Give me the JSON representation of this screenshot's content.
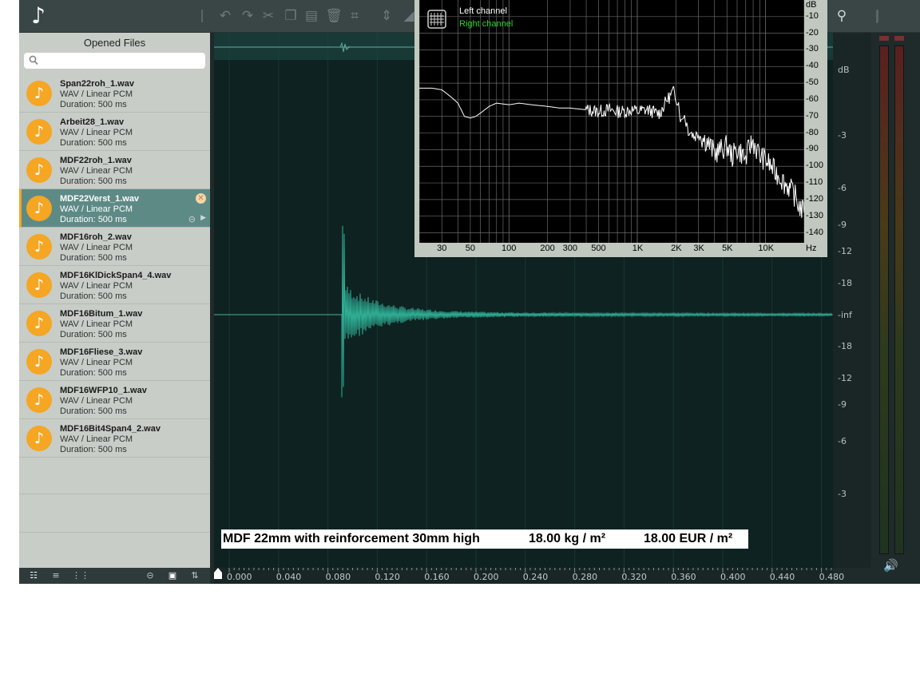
{
  "toolbar": {
    "logo_glyph": "♪",
    "buttons": [
      {
        "name": "undo-icon",
        "glyph": "↶"
      },
      {
        "name": "redo-icon",
        "glyph": "↷"
      },
      {
        "name": "cut-icon",
        "glyph": "✂"
      },
      {
        "name": "copy-icon",
        "glyph": "❐"
      },
      {
        "name": "paste-icon",
        "glyph": "▤"
      },
      {
        "name": "delete-icon",
        "glyph": "🗑"
      },
      {
        "name": "crop-icon",
        "glyph": "⌗"
      },
      {
        "name": "normalize-icon",
        "glyph": "⇕"
      },
      {
        "name": "fade-icon",
        "glyph": "◢"
      }
    ],
    "right_button": {
      "name": "tuning-fork-icon",
      "glyph": "⚲"
    }
  },
  "sidebar": {
    "title": "Opened Files",
    "search_placeholder": "",
    "files": [
      {
        "name": "Span22roh_1.wav",
        "format": "WAV / Linear PCM",
        "duration": "Duration: 500 ms",
        "selected": false
      },
      {
        "name": "Arbeit28_1.wav",
        "format": "WAV / Linear PCM",
        "duration": "Duration: 500 ms",
        "selected": false
      },
      {
        "name": "MDF22roh_1.wav",
        "format": "WAV / Linear PCM",
        "duration": "Duration: 500 ms",
        "selected": false
      },
      {
        "name": "MDF22Verst_1.wav",
        "format": "WAV / Linear PCM",
        "duration": "Duration: 500 ms",
        "selected": true
      },
      {
        "name": "MDF16roh_2.wav",
        "format": "WAV / Linear PCM",
        "duration": "Duration: 500 ms",
        "selected": false
      },
      {
        "name": "MDF16KlDickSpan4_4.wav",
        "format": "WAV / Linear PCM",
        "duration": "Duration: 500 ms",
        "selected": false
      },
      {
        "name": "MDF16Bitum_1.wav",
        "format": "WAV / Linear PCM",
        "duration": "Duration: 500 ms",
        "selected": false
      },
      {
        "name": "MDF16Fliese_3.wav",
        "format": "WAV / Linear PCM",
        "duration": "Duration: 500 ms",
        "selected": false
      },
      {
        "name": "MDF16WFP10_1.wav",
        "format": "WAV / Linear PCM",
        "duration": "Duration: 500 ms",
        "selected": false
      },
      {
        "name": "MDF16Bit4Span4_2.wav",
        "format": "WAV / Linear PCM",
        "duration": "Duration: 500 ms",
        "selected": false
      }
    ],
    "footer_buttons": [
      {
        "name": "detail-view-icon",
        "glyph": "☷"
      },
      {
        "name": "list-view-icon",
        "glyph": "≡"
      },
      {
        "name": "grid-view-icon",
        "glyph": "⋮⋮"
      },
      {
        "name": "link-icon",
        "glyph": "⊝"
      },
      {
        "name": "image-icon",
        "glyph": "▣"
      },
      {
        "name": "sort-icon",
        "glyph": "⇅"
      }
    ]
  },
  "waveform": {
    "db_scale_unit": "dB",
    "db_labels": [
      "-3",
      "-6",
      "-9",
      "-12",
      "-18",
      "-inf",
      "-18",
      "-12",
      "-9",
      "-6",
      "-3"
    ],
    "time_labels": [
      "0.000",
      "0.040",
      "0.080",
      "0.120",
      "0.160",
      "0.200",
      "0.240",
      "0.280",
      "0.320",
      "0.360",
      "0.400",
      "0.440",
      "0.480"
    ],
    "wave_color": "#2fae95"
  },
  "caption": {
    "description": "MDF 22mm with reinforcement 30mm high",
    "weight": "18.00 kg / m²",
    "price": "18.00 EUR / m²"
  },
  "spectrum": {
    "legend_left": "Left channel",
    "legend_right": "Right channel",
    "legend_left_color": "#ffffff",
    "legend_right_color": "#27d627",
    "y_unit": "dB",
    "x_unit": "Hz",
    "y_labels": [
      "-10",
      "-20",
      "-30",
      "-40",
      "-50",
      "-60",
      "-70",
      "-80",
      "-90",
      "-100",
      "-110",
      "-120",
      "-130",
      "-140"
    ],
    "x_labels": [
      "30",
      "50",
      "100",
      "200",
      "300",
      "500",
      "1K",
      "2K",
      "3K",
      "5K",
      "10K"
    ],
    "chart_data": {
      "type": "line",
      "title": "",
      "xlabel": "Hz",
      "ylabel": "dB",
      "xscale": "log",
      "xlim": [
        20,
        20000
      ],
      "ylim": [
        -146,
        0
      ],
      "grid": true,
      "legend": "top-left",
      "series": [
        {
          "name": "Left channel",
          "color": "#ffffff",
          "x": [
            20,
            25,
            30,
            35,
            40,
            45,
            50,
            55,
            60,
            70,
            80,
            100,
            120,
            150,
            200,
            250,
            300,
            400,
            500,
            600,
            700,
            800,
            900,
            1000,
            1200,
            1400,
            1500,
            1600,
            1700,
            1800,
            1900,
            2000,
            2100,
            2200,
            2300,
            2500,
            2800,
            3000,
            3200,
            3500,
            4000,
            4500,
            5000,
            5500,
            6000,
            6500,
            7000,
            7500,
            8000,
            9000,
            10000,
            11000,
            12000,
            13000,
            14000,
            15000,
            16000,
            17000,
            18000,
            20000
          ],
          "y": [
            -53,
            -53,
            -54,
            -58,
            -62,
            -70,
            -71,
            -70,
            -68,
            -64,
            -62,
            -63,
            -62,
            -63,
            -64,
            -65,
            -65,
            -66,
            -67,
            -66,
            -67,
            -67,
            -66,
            -67,
            -66,
            -68,
            -68,
            -64,
            -60,
            -58,
            -55,
            -58,
            -62,
            -74,
            -68,
            -78,
            -82,
            -80,
            -83,
            -85,
            -92,
            -90,
            -88,
            -94,
            -90,
            -92,
            -96,
            -88,
            -85,
            -94,
            -96,
            -100,
            -104,
            -106,
            -110,
            -112,
            -115,
            -118,
            -123,
            -128
          ]
        }
      ]
    }
  }
}
